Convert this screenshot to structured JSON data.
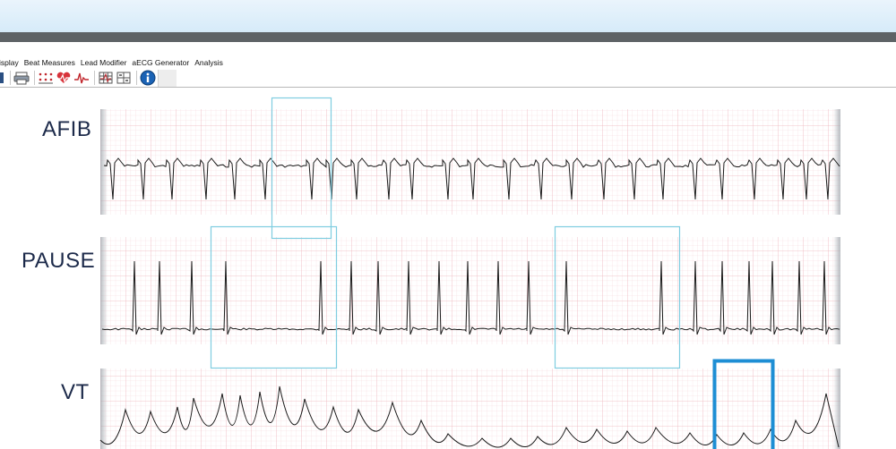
{
  "menu": {
    "items": [
      {
        "id": "display",
        "label": "isplay"
      },
      {
        "id": "beat-measures",
        "label": "Beat Measures"
      },
      {
        "id": "lead-modifier",
        "label": "Lead Modifier"
      },
      {
        "id": "aecg-generator",
        "label": "aECG Generator"
      },
      {
        "id": "analysis",
        "label": "Analysis"
      }
    ]
  },
  "toolbar": {
    "buttons": [
      {
        "icon": "partial-toolbar-icon"
      },
      {
        "icon": "print-icon"
      },
      {
        "icon": "grid-dots-icon"
      },
      {
        "icon": "heart-beat-icon"
      },
      {
        "icon": "waveform-icon"
      },
      {
        "icon": "grid-zoom-icon"
      },
      {
        "icon": "grid-layout-icon"
      },
      {
        "icon": "info-icon"
      }
    ]
  },
  "strips": {
    "afib": {
      "label": "AFIB"
    },
    "pause": {
      "label": "PAUSE"
    },
    "vt": {
      "label": "VT"
    }
  },
  "colors": {
    "grid_minor": "#f6d3d8",
    "grid_major": "#efb7bf",
    "trace": "#1a1a1a",
    "highlight": "#7fcde0",
    "highlight_bold": "#1e8ed4",
    "label": "#1c2a4a"
  }
}
